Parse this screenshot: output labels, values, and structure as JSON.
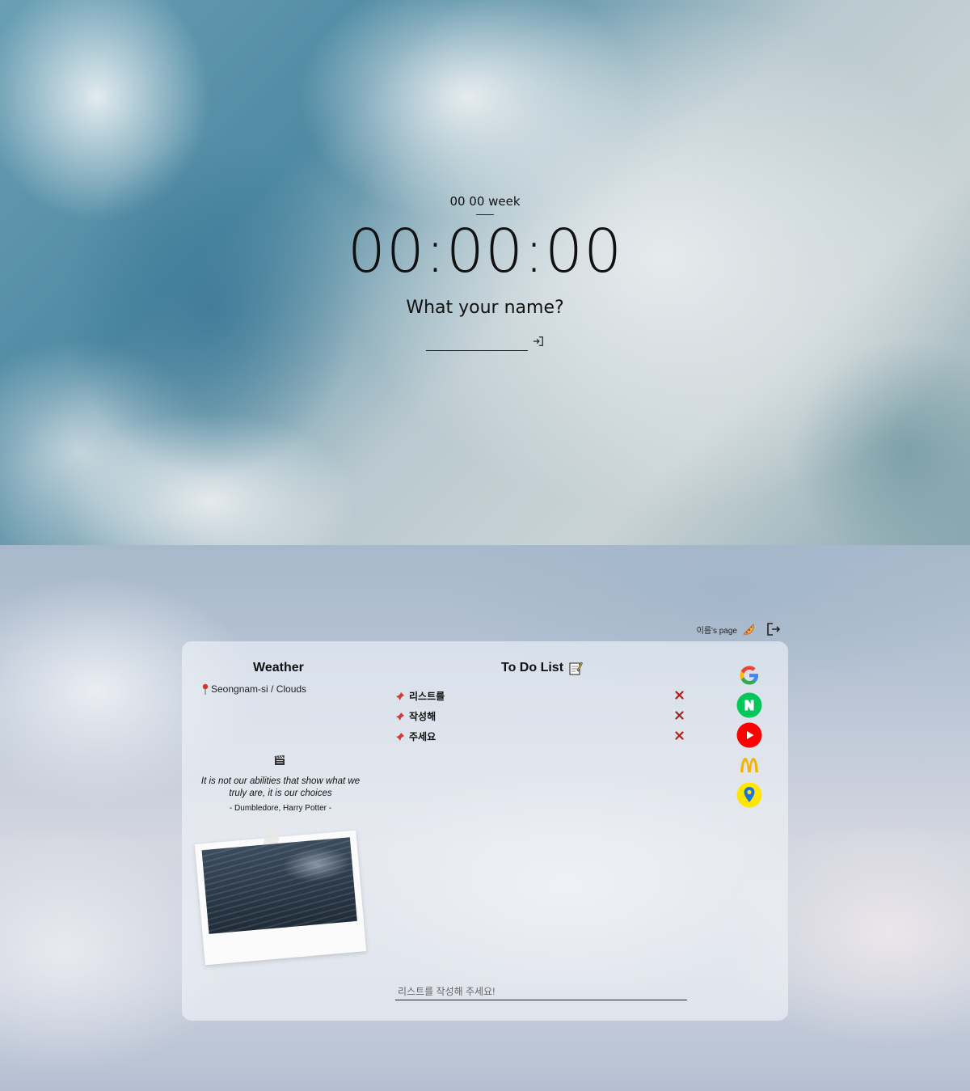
{
  "top": {
    "date_text": "00 00 week",
    "clock_text": "00:00:00",
    "question": "What your name?",
    "name_placeholder": ""
  },
  "user_bar": {
    "username": "이름's page"
  },
  "weather": {
    "title": "Weather",
    "location_condition": "Seongnam-si / Clouds"
  },
  "quote": {
    "text": "It is not our abilities that show what we truly are, it is our choices",
    "author": "- Dumbledore, Harry Potter -"
  },
  "todo": {
    "title": "To Do List",
    "items": [
      "리스트를",
      "작성해",
      "주세요"
    ],
    "input_placeholder": "리스트를 작성해 주세요!"
  },
  "links": [
    "google-icon",
    "naver-icon",
    "youtube-icon",
    "mcdonalds-icon",
    "map-pin-icon"
  ],
  "colors": {
    "google_blue": "#4285F4",
    "google_red": "#EA4335",
    "google_yellow": "#FBBC05",
    "google_green": "#34A853",
    "naver_green": "#03C75A",
    "youtube_red": "#FF0000",
    "mcd_yellow": "#F5B300",
    "map_yellow": "#FFE600",
    "delete_red": "#A8231C"
  }
}
